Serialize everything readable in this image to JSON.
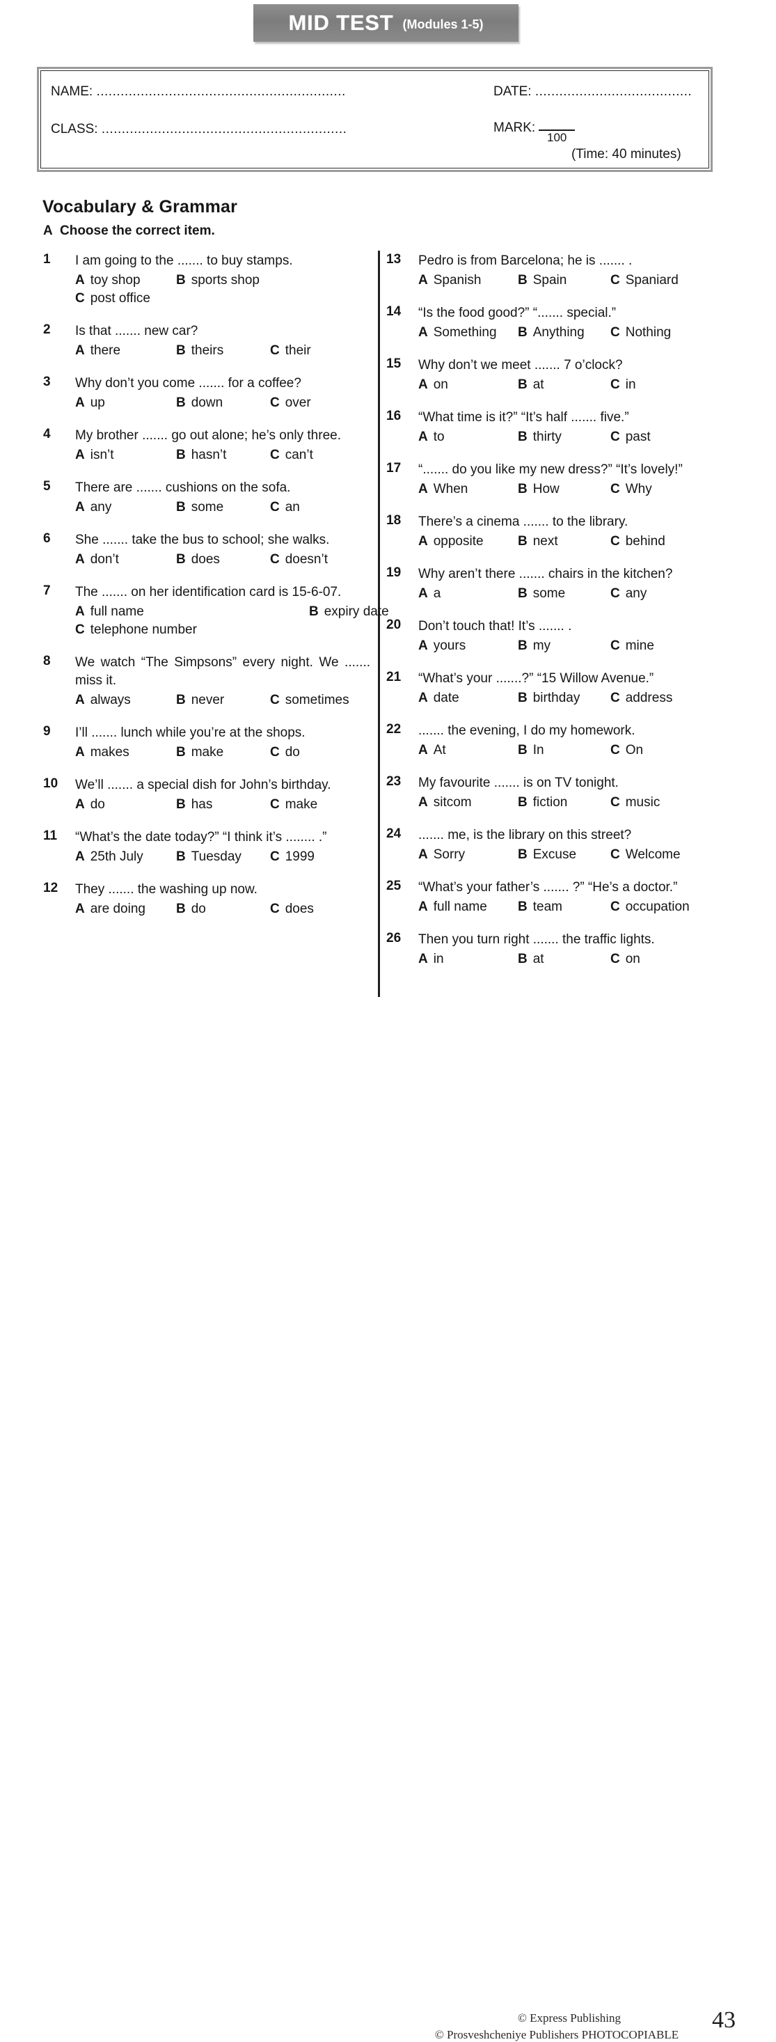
{
  "banner": {
    "title": "MID TEST",
    "subtitle": "(Modules 1-5)"
  },
  "info_box": {
    "name_label": "NAME:",
    "name_dots": "..............................................................",
    "class_label": "CLASS:",
    "class_dots": ".............................................................",
    "date_label": "DATE:",
    "date_dots": ".......................................",
    "mark_label": "MARK:",
    "mark_denominator": "100",
    "time_note": "(Time: 40 minutes)"
  },
  "section": {
    "title": "Vocabulary & Grammar",
    "part_letter": "A",
    "part_instruction": "Choose the correct item."
  },
  "questions": [
    {
      "num": "1",
      "text": "I am going to the ....... to buy stamps.",
      "justify": false,
      "layout": "wide",
      "options": [
        {
          "letter": "A",
          "text": "toy shop"
        },
        {
          "letter": "B",
          "text": "sports shop"
        },
        {
          "letter": "C",
          "text": "post office"
        }
      ]
    },
    {
      "num": "2",
      "text": "Is that ....... new car?",
      "justify": false,
      "layout": "inline",
      "options": [
        {
          "letter": "A",
          "text": "there"
        },
        {
          "letter": "B",
          "text": "theirs"
        },
        {
          "letter": "C",
          "text": "their"
        }
      ]
    },
    {
      "num": "3",
      "text": "Why don’t you come ....... for a coffee?",
      "justify": false,
      "layout": "inline",
      "options": [
        {
          "letter": "A",
          "text": "up"
        },
        {
          "letter": "B",
          "text": "down"
        },
        {
          "letter": "C",
          "text": "over"
        }
      ]
    },
    {
      "num": "4",
      "text": "My brother ....... go out alone; he’s only three.",
      "justify": true,
      "layout": "inline",
      "options": [
        {
          "letter": "A",
          "text": "isn’t"
        },
        {
          "letter": "B",
          "text": "hasn’t"
        },
        {
          "letter": "C",
          "text": "can’t"
        }
      ]
    },
    {
      "num": "5",
      "text": "There are ....... cushions on the sofa.",
      "justify": false,
      "layout": "inline",
      "options": [
        {
          "letter": "A",
          "text": "any"
        },
        {
          "letter": "B",
          "text": "some"
        },
        {
          "letter": "C",
          "text": "an"
        }
      ]
    },
    {
      "num": "6",
      "text": "She ....... take the bus to school; she walks.",
      "justify": false,
      "layout": "inline",
      "options": [
        {
          "letter": "A",
          "text": "don’t"
        },
        {
          "letter": "B",
          "text": "does"
        },
        {
          "letter": "C",
          "text": "doesn’t"
        }
      ]
    },
    {
      "num": "7",
      "text": "The ....... on her identification card is 15-6-07.",
      "justify": true,
      "layout": "twocol",
      "options": [
        {
          "letter": "A",
          "text": "full name"
        },
        {
          "letter": "B",
          "text": "expiry date"
        },
        {
          "letter": "C",
          "text": "telephone number"
        }
      ]
    },
    {
      "num": "8",
      "text": "We watch “The Simpsons” every night. We ....... miss it.",
      "justify": true,
      "layout": "inline",
      "options": [
        {
          "letter": "A",
          "text": "always"
        },
        {
          "letter": "B",
          "text": "never"
        },
        {
          "letter": "C",
          "text": "sometimes"
        }
      ]
    },
    {
      "num": "9",
      "text": "I’ll ....... lunch while you’re at the shops.",
      "justify": false,
      "layout": "inline",
      "options": [
        {
          "letter": "A",
          "text": "makes"
        },
        {
          "letter": "B",
          "text": "make"
        },
        {
          "letter": "C",
          "text": "do"
        }
      ]
    },
    {
      "num": "10",
      "text": "We’ll ....... a special dish for John’s birthday.",
      "justify": false,
      "layout": "inline",
      "options": [
        {
          "letter": "A",
          "text": "do"
        },
        {
          "letter": "B",
          "text": "has"
        },
        {
          "letter": "C",
          "text": "make"
        }
      ]
    },
    {
      "num": "11",
      "text": "“What’s the date today?” “I think it’s ........ .”",
      "justify": false,
      "layout": "inline",
      "options": [
        {
          "letter": "A",
          "text": "25th July"
        },
        {
          "letter": "B",
          "text": "Tuesday"
        },
        {
          "letter": "C",
          "text": "1999"
        }
      ]
    },
    {
      "num": "12",
      "text": "They ....... the washing up now.",
      "justify": false,
      "layout": "inline",
      "options": [
        {
          "letter": "A",
          "text": "are doing"
        },
        {
          "letter": "B",
          "text": "do"
        },
        {
          "letter": "C",
          "text": "does"
        }
      ]
    },
    {
      "num": "13",
      "text": "Pedro is from Barcelona; he is ....... .",
      "justify": false,
      "layout": "inline",
      "options": [
        {
          "letter": "A",
          "text": "Spanish"
        },
        {
          "letter": "B",
          "text": "Spain"
        },
        {
          "letter": "C",
          "text": "Spaniard"
        }
      ]
    },
    {
      "num": "14",
      "text": "“Is the food good?” “....... special.”",
      "justify": false,
      "layout": "inline",
      "options": [
        {
          "letter": "A",
          "text": "Something"
        },
        {
          "letter": "B",
          "text": "Anything"
        },
        {
          "letter": "C",
          "text": "Nothing"
        }
      ]
    },
    {
      "num": "15",
      "text": "Why don’t we meet ....... 7 o’clock?",
      "justify": false,
      "layout": "inline",
      "options": [
        {
          "letter": "A",
          "text": "on"
        },
        {
          "letter": "B",
          "text": "at"
        },
        {
          "letter": "C",
          "text": "in"
        }
      ]
    },
    {
      "num": "16",
      "text": "“What time is it?” “It’s half ....... five.”",
      "justify": false,
      "layout": "inline",
      "options": [
        {
          "letter": "A",
          "text": "to"
        },
        {
          "letter": "B",
          "text": "thirty"
        },
        {
          "letter": "C",
          "text": "past"
        }
      ]
    },
    {
      "num": "17",
      "text": "“....... do you like my new dress?” “It’s lovely!”",
      "justify": false,
      "layout": "inline",
      "options": [
        {
          "letter": "A",
          "text": "When"
        },
        {
          "letter": "B",
          "text": "How"
        },
        {
          "letter": "C",
          "text": "Why"
        }
      ]
    },
    {
      "num": "18",
      "text": "There’s a cinema ....... to the library.",
      "justify": false,
      "layout": "inline",
      "options": [
        {
          "letter": "A",
          "text": "opposite"
        },
        {
          "letter": "B",
          "text": "next"
        },
        {
          "letter": "C",
          "text": "behind"
        }
      ]
    },
    {
      "num": "19",
      "text": "Why aren’t there ....... chairs in the kitchen?",
      "justify": false,
      "layout": "inline",
      "options": [
        {
          "letter": "A",
          "text": "a"
        },
        {
          "letter": "B",
          "text": "some"
        },
        {
          "letter": "C",
          "text": "any"
        }
      ]
    },
    {
      "num": "20",
      "text": "Don’t touch that! It’s ....... .",
      "justify": false,
      "layout": "inline",
      "options": [
        {
          "letter": "A",
          "text": "yours"
        },
        {
          "letter": "B",
          "text": "my"
        },
        {
          "letter": "C",
          "text": "mine"
        }
      ]
    },
    {
      "num": "21",
      "text": "“What’s your .......?” “15  Willow Avenue.”",
      "justify": false,
      "layout": "inline",
      "options": [
        {
          "letter": "A",
          "text": "date"
        },
        {
          "letter": "B",
          "text": "birthday"
        },
        {
          "letter": "C",
          "text": "address"
        }
      ]
    },
    {
      "num": "22",
      "text": "....... the evening, I do my homework.",
      "justify": false,
      "layout": "inline",
      "options": [
        {
          "letter": "A",
          "text": "At"
        },
        {
          "letter": "B",
          "text": "In"
        },
        {
          "letter": "C",
          "text": "On"
        }
      ]
    },
    {
      "num": "23",
      "text": "My favourite ....... is on TV tonight.",
      "justify": false,
      "layout": "inline",
      "options": [
        {
          "letter": "A",
          "text": "sitcom"
        },
        {
          "letter": "B",
          "text": "fiction"
        },
        {
          "letter": "C",
          "text": "music"
        }
      ]
    },
    {
      "num": "24",
      "text": "....... me, is the library on this street?",
      "justify": false,
      "layout": "inline",
      "options": [
        {
          "letter": "A",
          "text": "Sorry"
        },
        {
          "letter": "B",
          "text": "Excuse"
        },
        {
          "letter": "C",
          "text": "Welcome"
        }
      ]
    },
    {
      "num": "25",
      "text": "“What’s your father’s ....... ?” “He’s a doctor.”",
      "justify": false,
      "layout": "inline",
      "options": [
        {
          "letter": "A",
          "text": "full name"
        },
        {
          "letter": "B",
          "text": "team"
        },
        {
          "letter": "C",
          "text": "occupation"
        }
      ]
    },
    {
      "num": "26",
      "text": "Then you turn right ....... the traffic lights.",
      "justify": false,
      "layout": "inline",
      "options": [
        {
          "letter": "A",
          "text": "in"
        },
        {
          "letter": "B",
          "text": "at"
        },
        {
          "letter": "C",
          "text": "on"
        }
      ]
    }
  ],
  "footer": {
    "credit_publisher": "© Express Publishing",
    "credit_photocopiable": "© Prosveshcheniye Publishers PHOTOCOPIABLE",
    "page_number": "43"
  }
}
